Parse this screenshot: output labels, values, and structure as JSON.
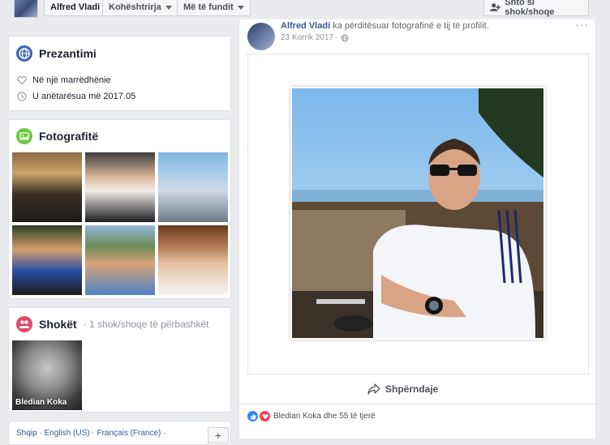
{
  "topbar": {
    "profile_name": "Alfred Vladi",
    "privacy_label": "Kohështrirja",
    "recent_label": "Më të fundit",
    "add_friend_label": "Shto si shok/shoqe"
  },
  "intro": {
    "title": "Prezantimi",
    "relationship": "Në një marrëdhënie",
    "joined": "U anëtarësua më 2017.05"
  },
  "photos": {
    "title": "Fotografitë"
  },
  "friends": {
    "title": "Shokët",
    "subtitle": "· 1 shok/shoqe të përbashkët",
    "friend_name": "Bledian Koka"
  },
  "footer": {
    "languages": "Shqip · English (US) · Français (France) ·",
    "add_label": "+"
  },
  "post": {
    "author": "Alfred Vladi",
    "action": "ka përditësuar fotografinë e tij të profilit.",
    "date": "23 Korrik 2017 ·",
    "share_label": "Shpërndaje",
    "reactions_text": "Bledian Koka dhe 55 të tjerë",
    "more": "···"
  },
  "colors": {
    "facebook_blue": "#4267b2",
    "link_blue": "#365899",
    "intro_icon": "#4267b2",
    "photos_icon": "#6bcb3d",
    "friends_icon": "#e2476a",
    "like_blue": "#2d88ff",
    "love_red": "#f33e58"
  }
}
